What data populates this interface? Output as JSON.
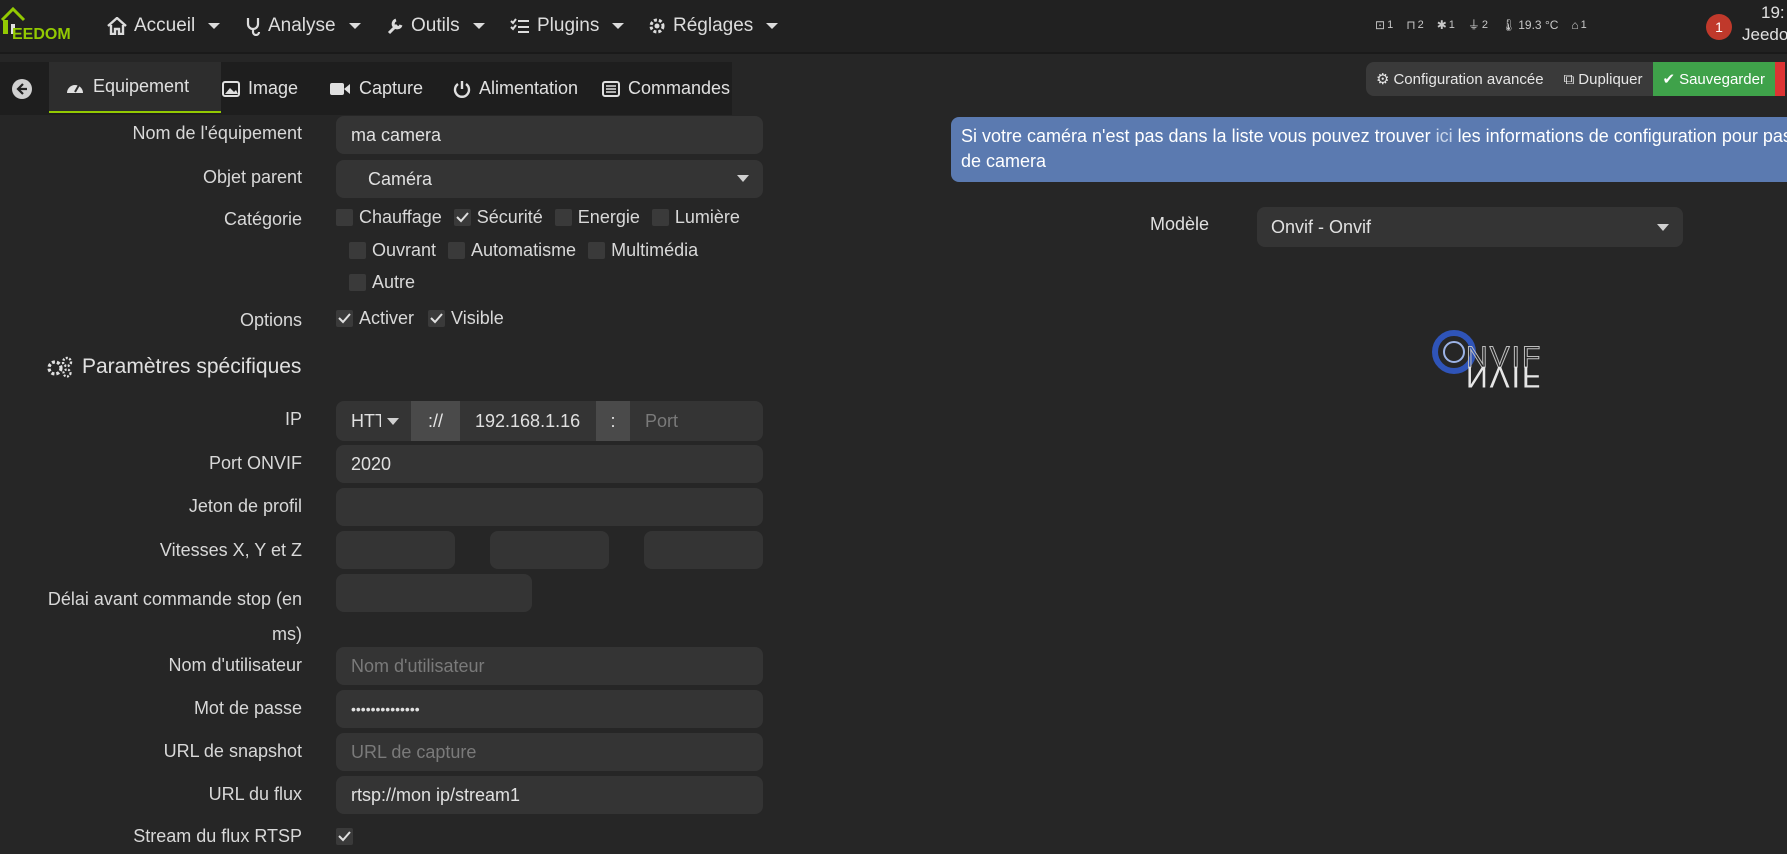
{
  "navbar": {
    "logo_text": "EEDOM",
    "items": [
      {
        "label": "Accueil",
        "icon": "home-icon"
      },
      {
        "label": "Analyse",
        "icon": "stethoscope-icon"
      },
      {
        "label": "Outils",
        "icon": "wrench-icon"
      },
      {
        "label": "Plugins",
        "icon": "tasks-icon"
      },
      {
        "label": "Réglages",
        "icon": "cog-icon"
      }
    ],
    "summary": [
      {
        "icon": "door-icon",
        "value": "1"
      },
      {
        "icon": "window-icon",
        "value": "2"
      },
      {
        "icon": "light-icon",
        "value": "1"
      },
      {
        "icon": "plug-icon",
        "value": "2"
      },
      {
        "icon": "thermometer-icon",
        "value": "19.3 °C"
      },
      {
        "icon": "garage-icon",
        "value": "1"
      }
    ],
    "notification_count": "1",
    "time": "19:",
    "user": "Jeedo"
  },
  "tabs": [
    {
      "label": "Equipement",
      "icon": "dashboard-icon",
      "active": true
    },
    {
      "label": "Image",
      "icon": "image-icon"
    },
    {
      "label": "Capture",
      "icon": "video-icon"
    },
    {
      "label": "Alimentation",
      "icon": "power-icon"
    },
    {
      "label": "Commandes",
      "icon": "list-icon"
    }
  ],
  "actions": {
    "advanced": "Configuration avancée",
    "duplicate": "Dupliquer",
    "save": "Sauvegarder"
  },
  "form": {
    "name_label": "Nom de l'équipement",
    "name_value": "ma camera",
    "parent_label": "Objet parent",
    "parent_value": "Caméra",
    "category_label": "Catégorie",
    "categories": [
      {
        "label": "Chauffage",
        "checked": false
      },
      {
        "label": "Sécurité",
        "checked": true
      },
      {
        "label": "Energie",
        "checked": false
      },
      {
        "label": "Lumière",
        "checked": false
      },
      {
        "label": "Ouvrant",
        "checked": false
      },
      {
        "label": "Automatisme",
        "checked": false
      },
      {
        "label": "Multimédia",
        "checked": false
      },
      {
        "label": "Autre",
        "checked": false
      }
    ],
    "options_label": "Options",
    "options": [
      {
        "label": "Activer",
        "checked": true
      },
      {
        "label": "Visible",
        "checked": true
      }
    ],
    "section_title": "Paramètres spécifiques",
    "ip_label": "IP",
    "ip_protocol": "HTTP",
    "ip_separator": "://",
    "ip_value": "192.168.1.16",
    "ip_colon": ":",
    "port_placeholder": "Port",
    "onvif_port_label": "Port ONVIF",
    "onvif_port_value": "2020",
    "profile_token_label": "Jeton de profil",
    "speed_label": "Vitesses X, Y et Z",
    "stop_delay_label_1": "Délai avant commande stop (en",
    "stop_delay_label_2": "ms)",
    "username_label": "Nom d'utilisateur",
    "username_placeholder": "Nom d'utilisateur",
    "password_label": "Mot de passe",
    "password_value": "••••••••••••••",
    "snapshot_label": "URL de snapshot",
    "snapshot_placeholder": "URL de capture",
    "stream_url_label": "URL du flux",
    "stream_url_value": "rtsp://mon ip/stream1",
    "rtsp_label": "Stream du flux RTSP"
  },
  "right": {
    "info_before": "Si votre caméra n'est pas dans la liste vous pouvez trouver ",
    "info_link": "ici",
    "info_after": " les informations de configuration pour pas n",
    "info_line2": "de camera",
    "model_label": "Modèle",
    "model_value": "Onvif - Onvif",
    "logo_text": "ONVIF"
  }
}
